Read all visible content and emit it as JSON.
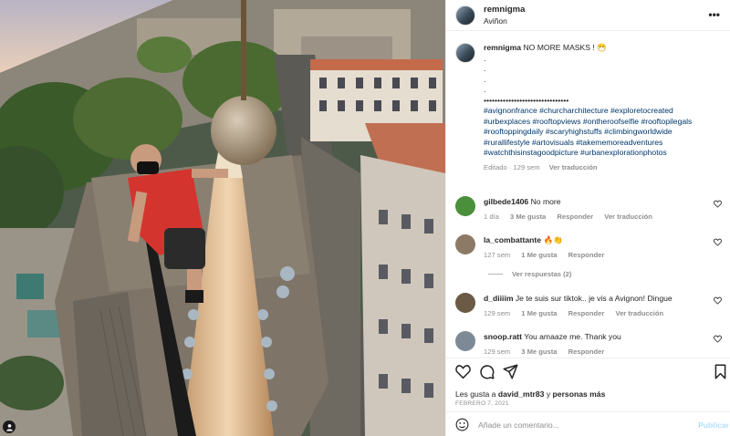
{
  "post": {
    "username": "remnigma",
    "location": "Aviñon"
  },
  "caption": {
    "username": "remnigma",
    "text": "NO MORE MASKS ! 😷",
    "dots": [
      ".",
      ".",
      ".",
      "."
    ],
    "bullet_line": "•••••••••••••••••••••••••••••••",
    "hashtags": "#avignonfrance #churcharchitecture #exploretocreated #urbexplaces #rooftopviews #ontheroofselfie #rooftopilegals #rooftoppingdaily #scaryhighstuffs #climbingworldwide #rurallifestyle #artovisuals #takememoreadventures #watchthisinstagoodpicture #urbanexplorationphotos",
    "edited": "Editado · 129 sem",
    "see_translation": "Ver traducción"
  },
  "comments": [
    {
      "username": "gilbede1406",
      "text": "No more",
      "time": "1 día",
      "likes": "3 Me gusta",
      "reply": "Responder",
      "translate": "Ver traducción",
      "avatar_color": "#4a8f3c"
    },
    {
      "username": "la_combattante",
      "text": "🔥👏",
      "time": "127 sem",
      "likes": "1 Me gusta",
      "reply": "Responder",
      "translate": "",
      "avatar_color": "#8c7a66"
    },
    {
      "username": "d_diiiim",
      "text": "Je te suis sur tiktok.. je vis a Avignon! Dingue",
      "time": "129 sem",
      "likes": "1 Me gusta",
      "reply": "Responder",
      "translate": "Ver traducción",
      "avatar_color": "#6b5a45"
    },
    {
      "username": "snoop.ratt",
      "text": "You amaaze me. Thank you",
      "time": "129 sem",
      "likes": "3 Me gusta",
      "reply": "Responder",
      "translate": "",
      "avatar_color": "#7d8a96"
    }
  ],
  "view_replies": "Ver respuestas (2)",
  "likes": {
    "prefix": "Les gusta a",
    "user": "david_mtr83",
    "middle": "y",
    "others": "personas más"
  },
  "date": "FEBRERO 7, 2021",
  "add_comment": {
    "placeholder": "Añade un comentario...",
    "publish": "Publicar"
  },
  "icons": [
    "heart-icon",
    "comment-icon",
    "share-icon",
    "bookmark-icon",
    "emoji-icon",
    "more-icon",
    "user-tag-icon"
  ],
  "colors": {
    "link": "#00376b",
    "muted": "#8e8e8e",
    "publish_disabled": "#b2dffc",
    "text": "#262626"
  }
}
